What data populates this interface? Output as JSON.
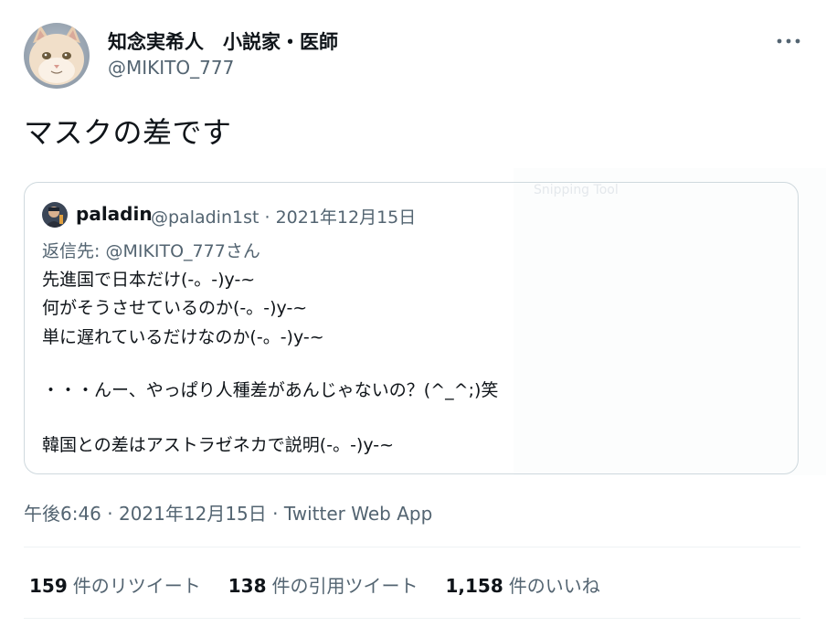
{
  "author": {
    "name": "知念実希人　小説家・医師",
    "handle": "@MIKITO_777"
  },
  "tweet": {
    "text": "マスクの差です"
  },
  "quote": {
    "name": "paladin",
    "meta": "@paladin1st · 2021年12月15日",
    "reply_to": "返信先: @MIKITO_777さん",
    "lines": [
      "先進国で日本だけ(-。-)y-~",
      "何がそうさせているのか(-。-)y-~",
      "単に遅れているだけなのか(-。-)y-~",
      "・・・んー、やっぱり人種差があんじゃないの？(^_^;)笑",
      "韓国との差はアストラゼネカで説明(-。-)y-~"
    ]
  },
  "watermark": "Snipping Tool",
  "timestamp": {
    "time_date": "午後6:46 · 2021年12月15日",
    "separator": " · ",
    "source": "Twitter Web App"
  },
  "stats": {
    "retweets_count": "159",
    "retweets_label": "件のリツイート",
    "quotes_count": "138",
    "quotes_label": "件の引用ツイート",
    "likes_count": "1,158",
    "likes_label": "件のいいね"
  },
  "icons": {
    "more": "more-horizontal-icon"
  }
}
